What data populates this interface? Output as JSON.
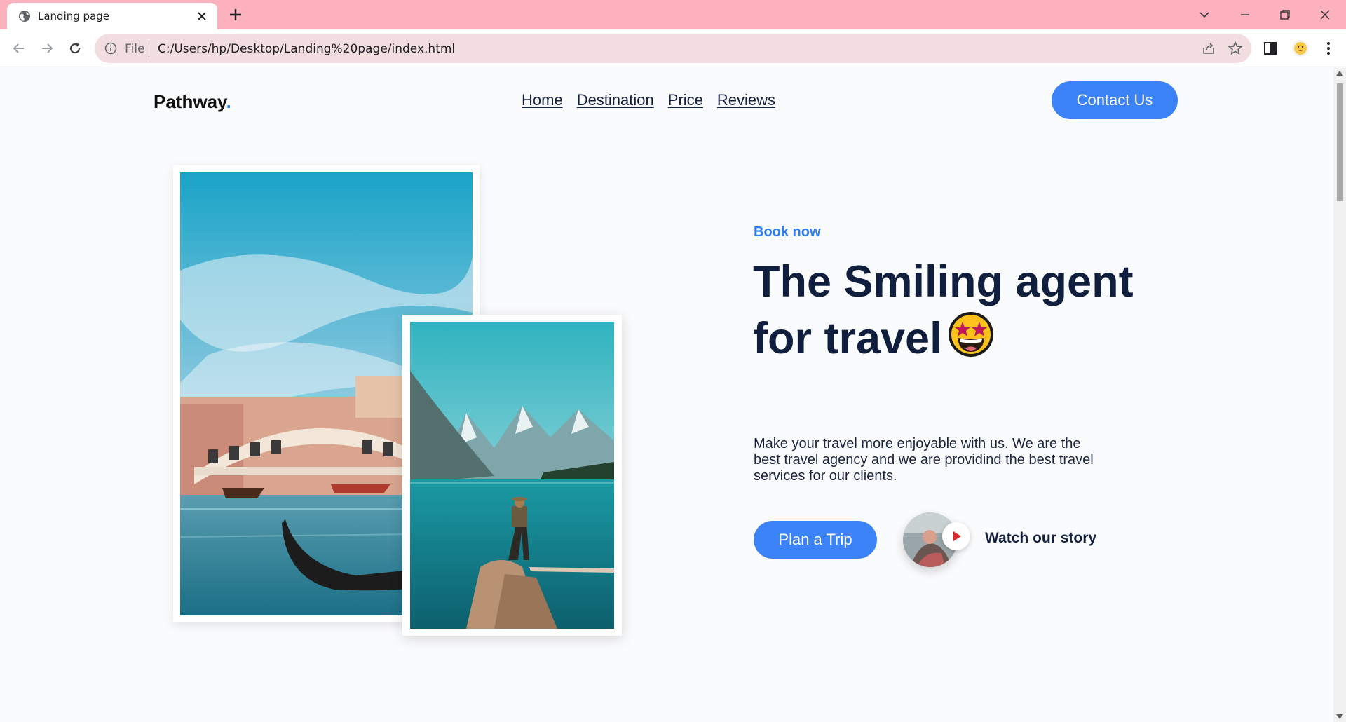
{
  "browser": {
    "tab_title": "Landing page",
    "scheme_label": "File",
    "url": "C:/Users/hp/Desktop/Landing%20page/index.html"
  },
  "site": {
    "logo_text": "Pathway",
    "logo_dot": ".",
    "nav": [
      "Home",
      "Destination",
      "Price",
      "Reviews"
    ],
    "contact_label": "Contact Us"
  },
  "hero": {
    "kicker": "Book now",
    "headline": "The Smiling agent for travel",
    "emoji": "star-struck-emoji",
    "description": "Make your travel more enjoyable with us. We are the best travel agency and we are providind the best travel services for our clients.",
    "cta_label": "Plan a Trip",
    "story_label": "Watch our story"
  },
  "colors": {
    "tab_strip": "#fdb0bd",
    "accent": "#3b82f6",
    "heading": "#0f1f3d"
  }
}
